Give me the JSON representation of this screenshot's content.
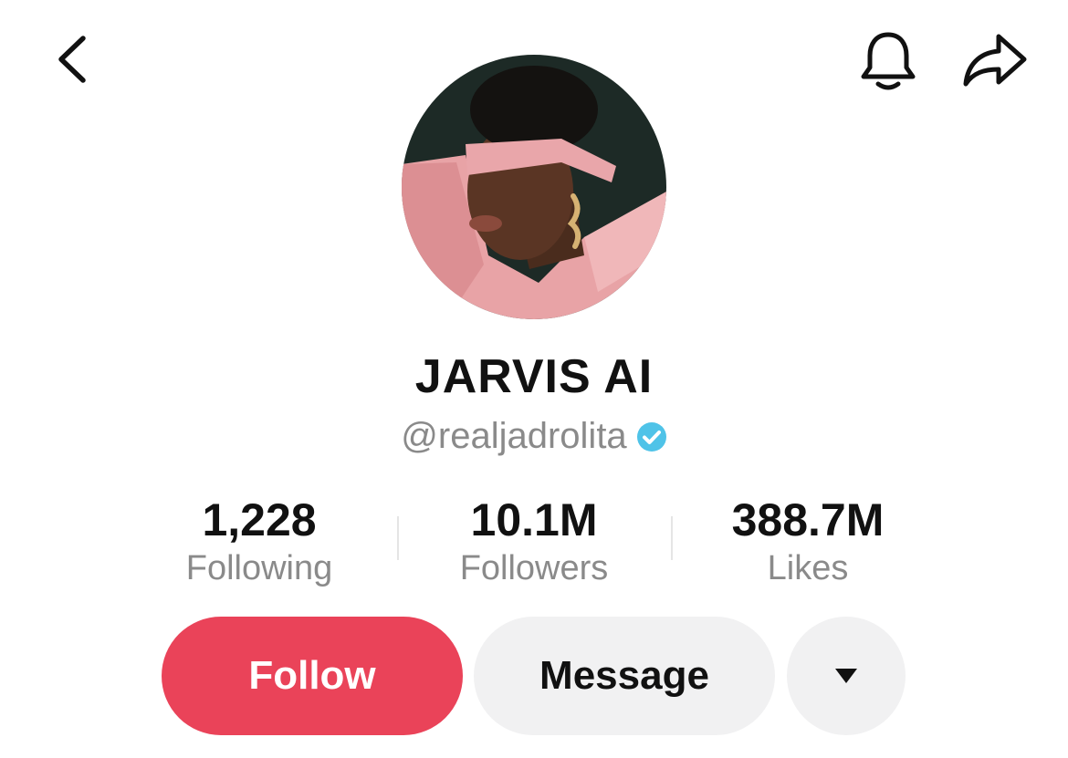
{
  "header": {
    "back_icon": "chevron-left-icon",
    "notify_icon": "bell-icon",
    "share_icon": "share-arrow-icon"
  },
  "profile": {
    "display_name": "JARVIS AI",
    "handle": "@realjadrolita",
    "verified": true,
    "verified_color": "#4fc3e8"
  },
  "stats": [
    {
      "value": "1,228",
      "label": "Following"
    },
    {
      "value": "10.1M",
      "label": "Followers"
    },
    {
      "value": "388.7M",
      "label": "Likes"
    }
  ],
  "actions": {
    "follow_label": "Follow",
    "message_label": "Message",
    "more_icon": "caret-down-icon",
    "follow_color": "#ea4359"
  }
}
